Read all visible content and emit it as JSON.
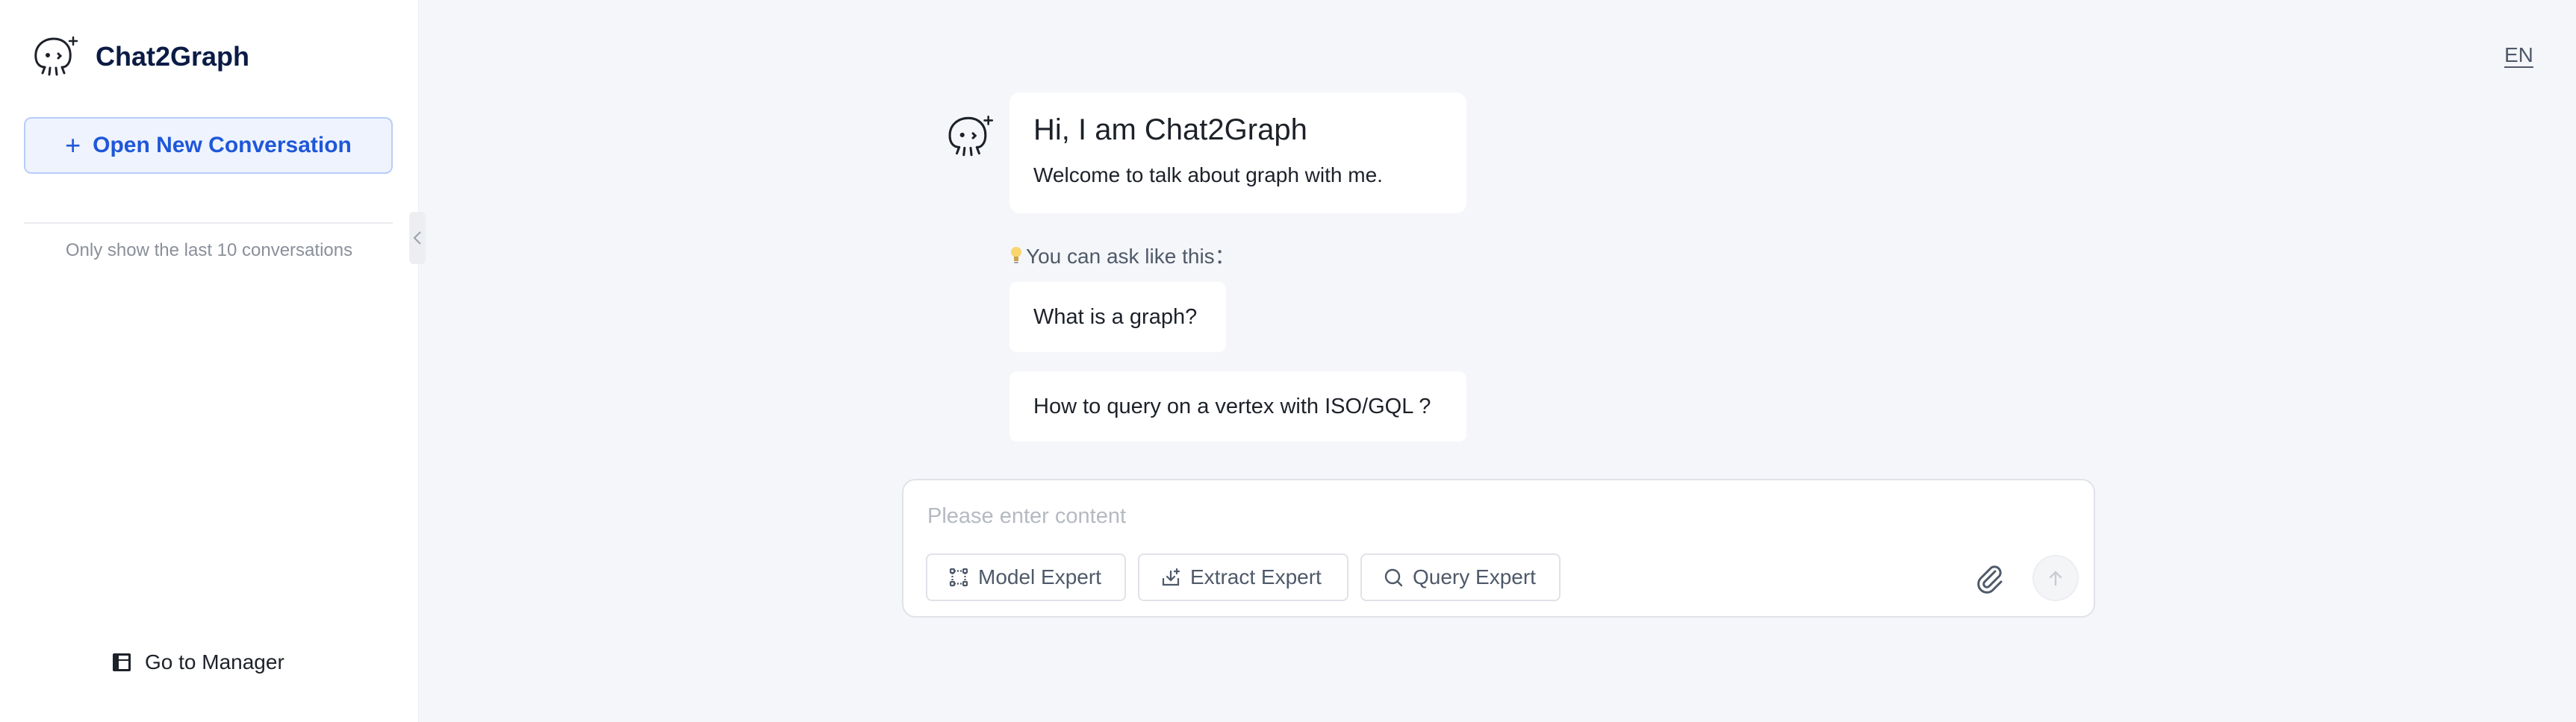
{
  "app": {
    "name": "Chat2Graph"
  },
  "sidebar": {
    "new_conversation_label": "Open New Conversation",
    "history_hint": "Only show the last 10 conversations",
    "go_manager_label": "Go to Manager"
  },
  "header": {
    "language": "EN"
  },
  "welcome": {
    "title": "Hi, I am Chat2Graph",
    "subtitle": "Welcome to talk about graph with me.",
    "ask_hint": "You can ask like this："
  },
  "suggestions": [
    "What is a graph?",
    "How to query on a vertex with ISO/GQL ?"
  ],
  "composer": {
    "placeholder": "Please enter content",
    "experts": [
      "Model Expert",
      "Extract Expert",
      "Query Expert"
    ]
  },
  "icons": {
    "logo": "octopus-logo-icon",
    "bulb": "lightbulb-icon",
    "attach": "paperclip-icon",
    "send": "arrow-up-icon"
  },
  "colors": {
    "accent": "#1f57d8",
    "brand_text": "#0b1b45",
    "background": "#f5f6f9"
  }
}
